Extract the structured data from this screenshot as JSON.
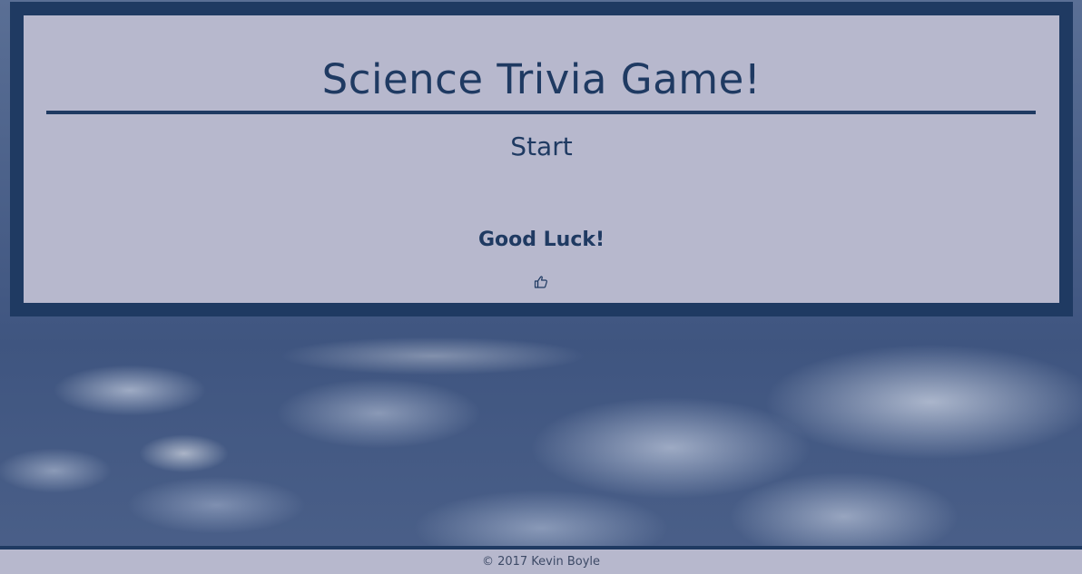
{
  "header": {
    "title": "Science Trivia Game!"
  },
  "main": {
    "start_label": "Start",
    "good_luck_text": "Good Luck!",
    "good_luck_icon": "thumbs-up-icon"
  },
  "footer": {
    "copyright": "© 2017 Kevin Boyle"
  },
  "colors": {
    "panel_background": "#b7b8cd",
    "panel_border": "#1f3a62",
    "text": "#1f3a62"
  }
}
